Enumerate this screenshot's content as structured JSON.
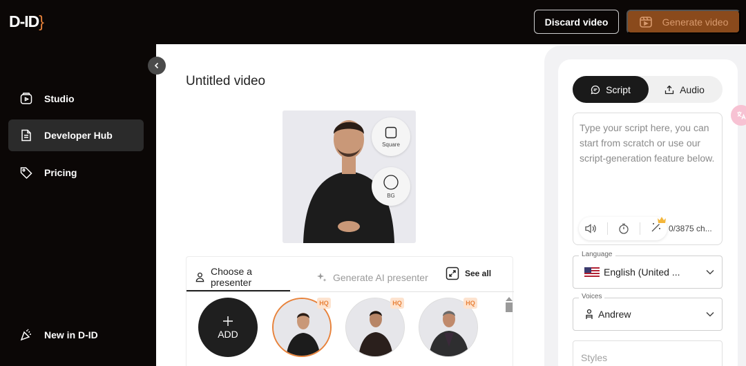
{
  "header": {
    "logo_text": "D-ID",
    "discard_label": "Discard video",
    "generate_label": "Generate video"
  },
  "sidebar": {
    "items": [
      {
        "label": "Studio",
        "icon": "studio-icon",
        "active": false
      },
      {
        "label": "Developer Hub",
        "icon": "document-icon",
        "active": true
      },
      {
        "label": "Pricing",
        "icon": "tag-icon",
        "active": false
      }
    ],
    "footer_item": {
      "label": "New in D-ID",
      "icon": "party-popper-icon"
    }
  },
  "main": {
    "title": "Untitled video",
    "preview_options": [
      {
        "label": "Square",
        "icon": "square-icon"
      },
      {
        "label": "BG",
        "icon": "circle-icon"
      }
    ],
    "tabs": [
      {
        "label": "Choose a presenter",
        "icon": "user-icon",
        "active": true
      },
      {
        "label": "Generate AI presenter",
        "icon": "sparkle-icon",
        "active": false
      }
    ],
    "see_all_label": "See all",
    "add_label": "ADD",
    "hq_badge": "HQ"
  },
  "right_panel": {
    "segments": [
      {
        "label": "Script",
        "icon": "chat-icon",
        "active": true
      },
      {
        "label": "Audio",
        "icon": "upload-icon",
        "active": false
      }
    ],
    "script_placeholder": "Type your script here, you can start from scratch or use our script-generation feature below.",
    "char_count": "0/3875 ch...",
    "language": {
      "label": "Language",
      "value": "English (United ..."
    },
    "voices": {
      "label": "Voices",
      "value": "Andrew"
    },
    "styles_placeholder": "Styles"
  },
  "colors": {
    "accent": "#e8823a",
    "generate_bg": "#8a4a1c",
    "sidebar_bg": "#0b0706"
  }
}
